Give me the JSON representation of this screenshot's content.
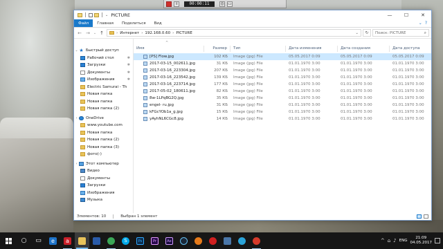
{
  "recorder": {
    "time": "00:00:11",
    "buttons": [
      "stop-icon",
      "pause-icon",
      "camera-icon",
      "window-icon"
    ]
  },
  "window": {
    "title": "PICTURE",
    "controls": {
      "minimize": "—",
      "maximize": "☐",
      "close": "✕"
    }
  },
  "ribbon": {
    "tabs": [
      "Файл",
      "Главная",
      "Поделиться",
      "Вид"
    ],
    "expand_glyph": "⌄",
    "help_glyph": "?"
  },
  "address": {
    "back": "←",
    "forward": "→",
    "recent": "⌄",
    "up": "↑",
    "crumbs": [
      "Интернет",
      "192.168.0.60",
      "PICTURE"
    ],
    "crumb_sep": "›",
    "dropdown": "⌄",
    "refresh": "↻",
    "search_placeholder": "Поиск: PICTURE",
    "search_glyph": "⌕"
  },
  "nav": {
    "pin_glyph": "✱",
    "chev_open": "⌄",
    "chev_closed": "›",
    "quick_access": "Быстрый доступ",
    "quick_items": [
      "Рабочий стол",
      "Загрузки",
      "Документы",
      "Изображения",
      "Electric Samurai - Th",
      "Новая папка",
      "Новая папка",
      "Новая папка (2)"
    ],
    "onedrive": "OneDrive",
    "onedrive_items": [
      "www.youtube.com",
      "Новая папка",
      "Новая папка (2)",
      "Новая папка (3)",
      "фото(-)"
    ],
    "this_pc": "Этот компьютер",
    "pc_items": [
      "Видео",
      "Документы",
      "Загрузки",
      "Изображения",
      "Музыка"
    ]
  },
  "files": {
    "sort_glyph": "^",
    "columns": [
      "Имя",
      "Размер",
      "Тип",
      "Дата изменения",
      "Дата создания",
      "Дата доступа"
    ],
    "rows": [
      [
        "[PS] Flow.jpg",
        "102 КБ",
        "Image (jpg) File",
        "05.05.2017 0:09",
        "05.05.2017 0:09",
        "05.05.2017 0:09"
      ],
      [
        "2017-03-15_002611.jpg",
        "31 КБ",
        "Image (jpg) File",
        "01.01.1970 3:00",
        "01.01.1970 3:00",
        "01.01.1970 3:00"
      ],
      [
        "2017-03-16_223304.jpg",
        "207 КБ",
        "Image (jpg) File",
        "01.01.1970 3:00",
        "01.01.1970 3:00",
        "01.01.1970 3:00"
      ],
      [
        "2017-03-16_223542.jpg",
        "139 КБ",
        "Image (jpg) File",
        "01.01.1970 3:00",
        "01.01.1970 3:00",
        "01.01.1970 3:00"
      ],
      [
        "2017-03-16_223714.jpg",
        "177 КБ",
        "Image (jpg) File",
        "01.01.1970 3:00",
        "01.01.1970 3:00",
        "01.01.1970 3:00"
      ],
      [
        "2017-05-02_180611.jpg",
        "82 КБ",
        "Image (jpg) File",
        "01.01.1970 3:00",
        "01.01.1970 3:00",
        "01.01.1970 3:00"
      ],
      [
        "8w-1LPqBG2Q.jpg",
        "35 КБ",
        "Image (jpg) File",
        "01.01.1970 3:00",
        "01.01.1970 3:00",
        "01.01.1970 3:00"
      ],
      [
        "engel- ru.jpg",
        "31 КБ",
        "Image (jpg) File",
        "01.01.1970 3:00",
        "01.01.1970 3:00",
        "01.01.1970 3:00"
      ],
      [
        "kFGcYOb1a_g.jpg",
        "15 КБ",
        "Image (jpg) File",
        "01.01.1970 3:00",
        "01.01.1970 3:00",
        "01.01.1970 3:00"
      ],
      [
        "yAyhNL6CGc8.jpg",
        "14 КБ",
        "Image (jpg) File",
        "01.01.1970 3:00",
        "01.01.1970 3:00",
        "01.01.1970 3:00"
      ]
    ]
  },
  "status": {
    "count": "Элементов: 10",
    "selected": "Выбран 1 элемент"
  },
  "taskbar": {
    "apps": [
      {
        "icon": "search-icon",
        "color": "#161616",
        "glyph": "○"
      },
      {
        "icon": "task-view-icon",
        "color": "#161616",
        "glyph": "▭"
      },
      {
        "icon": "edge-icon",
        "color": "#1e73c8",
        "glyph": "e"
      },
      {
        "icon": "adobe-icon",
        "color": "#c8202a",
        "glyph": "a"
      },
      {
        "icon": "explorer-icon",
        "color": "#e8c35a",
        "glyph": ""
      },
      {
        "icon": "store-icon",
        "color": "#2a5ba8",
        "glyph": ""
      },
      {
        "icon": "chrome-icon",
        "color": "#3aa757",
        "glyph": ""
      },
      {
        "icon": "skype-icon",
        "color": "#00a8e8",
        "glyph": "S"
      },
      {
        "icon": "photoshop-icon",
        "color": "#0c2e4e",
        "glyph": "Ps"
      },
      {
        "icon": "premiere-icon",
        "color": "#2a0c4e",
        "glyph": "Pr"
      },
      {
        "icon": "aftereffects-icon",
        "color": "#1a0c3e",
        "glyph": "Ae"
      },
      {
        "icon": "steam-icon",
        "color": "#1b2838",
        "glyph": ""
      },
      {
        "icon": "media-icon",
        "color": "#e57a1a",
        "glyph": ""
      },
      {
        "icon": "yandex-icon",
        "color": "#d02020",
        "glyph": ""
      },
      {
        "icon": "vk-icon",
        "color": "#4a76a8",
        "glyph": ""
      },
      {
        "icon": "telegram-icon",
        "color": "#2aa3d8",
        "glyph": ""
      },
      {
        "icon": "recorder-icon",
        "color": "#d43a2a",
        "glyph": ""
      }
    ],
    "tray": {
      "up_glyph": "^",
      "net_glyph": "⌂",
      "vol_glyph": "♪",
      "lang": "ENG",
      "time": "21:09",
      "date": "04.05.2017"
    }
  }
}
